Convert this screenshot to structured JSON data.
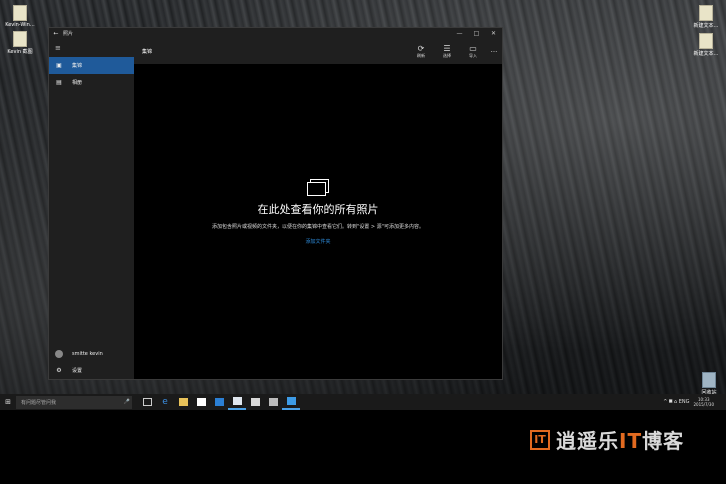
{
  "desktop": {
    "icons": [
      {
        "label": "Kevin-Win…"
      },
      {
        "label": "Kevin 截图"
      },
      {
        "label": "新建文本…"
      },
      {
        "label": "新建文本…"
      },
      {
        "label": "回收站"
      }
    ]
  },
  "window": {
    "title": "照片",
    "back_glyph": "←",
    "minimize_glyph": "—",
    "maximize_glyph": "□",
    "close_glyph": "✕"
  },
  "sidebar": {
    "menu_glyph": "≡",
    "items": [
      {
        "label": "集锦",
        "icon": "collection-icon",
        "active": true
      },
      {
        "label": "相册",
        "icon": "album-icon",
        "active": false
      }
    ],
    "account_name": "smitte kevin",
    "settings_label": "设置"
  },
  "main": {
    "title": "集锦",
    "commands": [
      {
        "label": "刷新",
        "icon": "refresh-icon"
      },
      {
        "label": "选择",
        "icon": "select-icon"
      },
      {
        "label": "导入",
        "icon": "import-icon"
      }
    ],
    "more_glyph": "···",
    "empty_title": "在此处查看你的所有照片",
    "empty_desc": "添加包含照片或视频的文件夹，以便在你的集锦中查看它们。转到\"设置 > 源\"可添加更多内容。",
    "empty_link": "添加文件夹"
  },
  "taskbar": {
    "start_glyph": "⊞",
    "search_placeholder": "有问题尽管问我",
    "clock_time": "10:33",
    "clock_date": "2015/7/30",
    "tray_text": "^ 𝄜 ⌂ ENG"
  },
  "watermark": {
    "mark": "IT",
    "text_a": "逍遥乐",
    "text_it": "IT",
    "text_b": "博客"
  },
  "colors": {
    "accent": "#1f5a9a",
    "link": "#2f8fe0",
    "logo_orange": "#e26a20"
  }
}
